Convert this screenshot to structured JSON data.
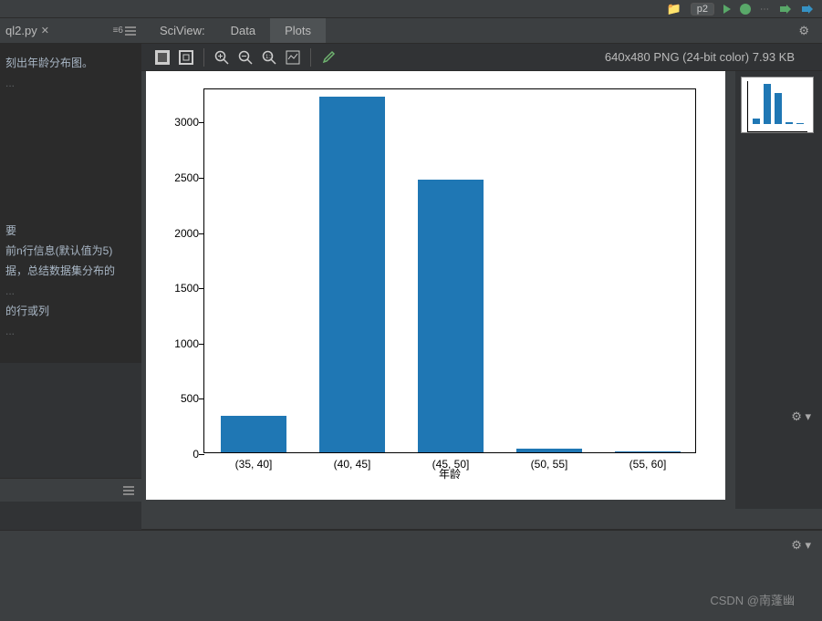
{
  "top": {
    "run_config": "p2"
  },
  "editor": {
    "tab_filename": "ql2.py",
    "lines_indicator": "≡6",
    "line_a": "刻出年龄分布图。",
    "collapse_a": "...",
    "line_b": "要",
    "line_c": "前n行信息(默认值为5)",
    "line_d": "据，总结数据集分布的",
    "collapse_b": "...",
    "line_e": "的行或列",
    "collapse_c": "..."
  },
  "sciview": {
    "title": "SciView:",
    "tab_data": "Data",
    "tab_plots": "Plots",
    "image_info": "640x480 PNG (24-bit color) 7.93 KB"
  },
  "chart_data": {
    "type": "bar",
    "categories": [
      "(35, 40]",
      "(40, 45]",
      "(45, 50]",
      "(50, 55]",
      "(55, 60]"
    ],
    "values": [
      330,
      3220,
      2470,
      30,
      8
    ],
    "xlabel": "年龄",
    "ylabel": "",
    "ylim": [
      0,
      3300
    ],
    "yticks": [
      0,
      500,
      1000,
      1500,
      2000,
      2500,
      3000
    ]
  },
  "watermark": "CSDN @南蓬幽"
}
